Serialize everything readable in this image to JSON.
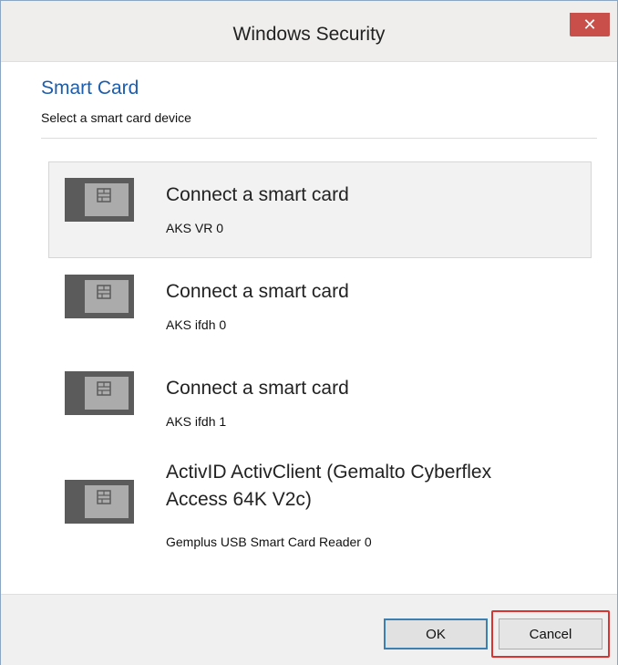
{
  "window": {
    "title": "Windows Security",
    "close_glyph": "✕"
  },
  "dialog": {
    "heading": "Smart Card",
    "subheading": "Select a smart card device"
  },
  "devices": [
    {
      "title": "Connect a smart card",
      "reader": "AKS VR 0",
      "icon": "smart-card-icon",
      "selected": true
    },
    {
      "title": "Connect a smart card",
      "reader": "AKS ifdh 0",
      "icon": "smart-card-icon",
      "selected": false
    },
    {
      "title": "Connect a smart card",
      "reader": "AKS ifdh 1",
      "icon": "smart-card-icon",
      "selected": false
    },
    {
      "title": "ActivID ActivClient (Gemalto Cyberflex Access 64K V2c)",
      "reader": "Gemplus USB Smart Card Reader 0",
      "icon": "smart-card-icon",
      "selected": false
    }
  ],
  "buttons": {
    "ok": "OK",
    "cancel": "Cancel"
  },
  "colors": {
    "heading": "#1c5dad",
    "close_button": "#c9504a",
    "highlight": "#d9342f"
  }
}
